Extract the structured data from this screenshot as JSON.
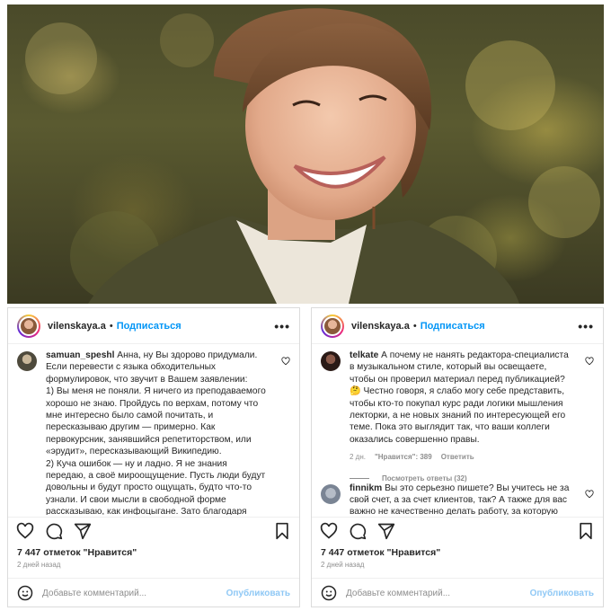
{
  "post_author": "vilenskaya.a",
  "follow_label": "Подписаться",
  "header_separator": "•",
  "more_label": "•••",
  "left": {
    "comment": {
      "user": "samuan_speshl",
      "text": "Анна, ну Вы здорово придумали. Если перевести с языка обходительных формулировок, что звучит в Вашем заявлении:\n1) Вы меня не поняли. Я ничего из преподаваемого хорошо не знаю. Пройдусь по верхам, потому что мне интересно было самой почитать, и пересказываю другим — примерно. Как первокурсник, занявшийся репетиторством, или «эрудит», пересказывающий Википедию.\n2) Куча ошибок — ну и ладно. Я не знания передаю, а своё мироощущение. Пусть люди будут довольны и будут просто ощущать, будто что-то узнали. И свои мысли в свободной форме рассказываю, как инфоцыгане. Зато благодаря настоящим экспертам, исправляющим мои ошибки, что-то узнала, чему-то научилась.\n3) Те кто против — вы хотите помешать мне осуществить Мечту: узнать обо всём поверхностно, чтобы потом"
    },
    "likes": "7 447 отметок \"Нравится\"",
    "date": "2 дней назад"
  },
  "right": {
    "comments": [
      {
        "user": "telkate",
        "text": "А почему не нанять редактора-специалиста в музыкальном стиле, который вы освещаете, чтобы он проверил материал перед публикацией? 🤔 Честно говоря, я слабо могу себе представить, чтобы кто-то покупал курс ради логики мышления лекторки, а не новых знаний по интересующей его теме. Пока это выглядит так, что ваши коллеги оказались совершенно правы.",
        "time": "2 дн.",
        "likes": "\"Нравится\": 389",
        "reply": "Ответить",
        "view_replies": "Посмотреть ответы (32)"
      },
      {
        "user": "finnikm",
        "text": "Вы это серьезно пишете? Вы учитесь не за свой счет, а за счет клиентов, так? А также для вас важно не качественно делать работу, за которую берете деньги, а то, что у вас есть цель к 50-ти что-то успеть и другим путем"
      }
    ],
    "likes": "7 447 отметок \"Нравится\"",
    "date": "2 дней назад"
  },
  "add_comment_placeholder": "Добавьте комментарий...",
  "publish_label": "Опубликовать",
  "icons": {
    "like": "heart-icon",
    "comment": "comment-icon",
    "share": "share-icon",
    "save": "bookmark-icon",
    "emoji": "smiley-icon"
  },
  "colors": {
    "accent": "#0095f6",
    "publish_disabled": "#8fc8f5",
    "muted": "#8e8e8e"
  }
}
